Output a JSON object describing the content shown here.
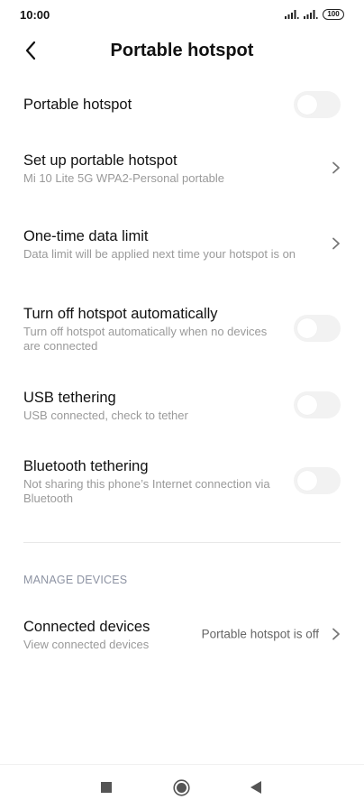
{
  "status_bar": {
    "time": "10:00",
    "battery": "100",
    "icons": [
      "signal-1-icon",
      "signal-2-icon",
      "battery-icon"
    ]
  },
  "header": {
    "title": "Portable hotspot",
    "back_icon": "chevron-left-icon"
  },
  "settings": {
    "portable_hotspot": {
      "title": "Portable hotspot",
      "enabled": false
    },
    "setup": {
      "title": "Set up portable hotspot",
      "subtitle": "Mi 10 Lite 5G WPA2-Personal portable"
    },
    "data_limit": {
      "title": "One-time data limit",
      "subtitle": "Data limit will be applied next time your hotspot is on"
    },
    "auto_off": {
      "title": "Turn off hotspot automatically",
      "subtitle": "Turn off hotspot automatically when no devices are connected",
      "enabled": false
    },
    "usb": {
      "title": "USB tethering",
      "subtitle": "USB connected, check to tether",
      "enabled": false
    },
    "bluetooth": {
      "title": "Bluetooth tethering",
      "subtitle": "Not sharing this phone’s Internet connection via Bluetooth",
      "enabled": false
    }
  },
  "manage": {
    "section_label": "MANAGE DEVICES",
    "connected": {
      "title": "Connected devices",
      "subtitle": "View connected devices",
      "value": "Portable hotspot is off"
    }
  },
  "nav": {
    "icons": [
      "recents-square-icon",
      "home-circle-icon",
      "back-triangle-icon"
    ]
  },
  "colors": {
    "toggle_off": "#f2f2f2",
    "subtitle": "#9a9a9a",
    "section": "#8d93a3"
  }
}
